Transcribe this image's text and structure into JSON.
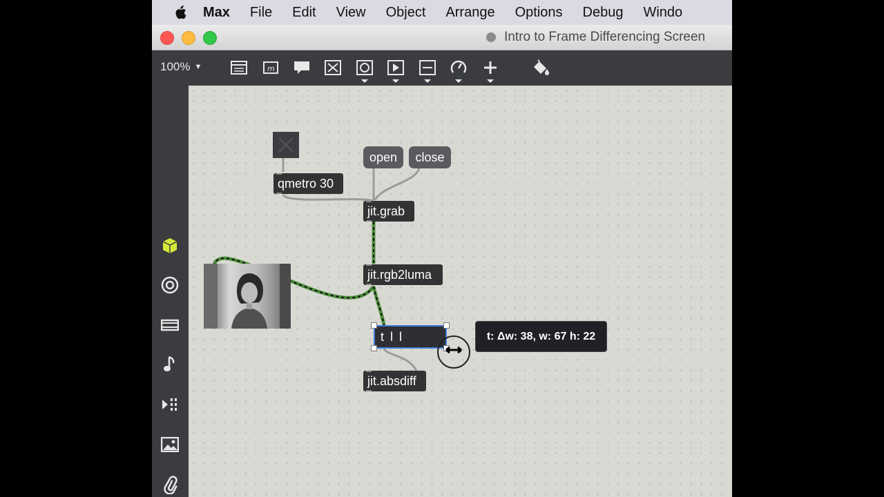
{
  "menubar": {
    "app": "Max",
    "items": [
      "File",
      "Edit",
      "View",
      "Object",
      "Arrange",
      "Options",
      "Debug",
      "Windo"
    ]
  },
  "window": {
    "title": "Intro to Frame Differencing Screen"
  },
  "toolbar": {
    "zoom": "100%",
    "tools": [
      "presentation",
      "message",
      "comment",
      "toggle",
      "button",
      "playbar",
      "slider",
      "dial",
      "add",
      "paint-bucket"
    ]
  },
  "sidebar": {
    "icons": [
      "package-icon",
      "target-icon",
      "video-icon",
      "music-note-icon",
      "playlist-icon",
      "image-icon",
      "paperclip-icon"
    ],
    "active_color": "#d4e83a"
  },
  "patcher": {
    "objects": {
      "qmetro": "qmetro 30",
      "grab": "jit.grab",
      "rgb2luma": "jit.rgb2luma",
      "trigger": "t l l",
      "absdiff": "jit.absdiff"
    },
    "messages": {
      "open": "open",
      "close": "close"
    },
    "tooltip": "t: Δw: 38, w: 67 h: 22"
  },
  "colors": {
    "canvas": "#d9d9d4",
    "toolbar": "#3a3c40",
    "matrix_cable": "#5fa34a",
    "selection": "#3f7bd9"
  }
}
